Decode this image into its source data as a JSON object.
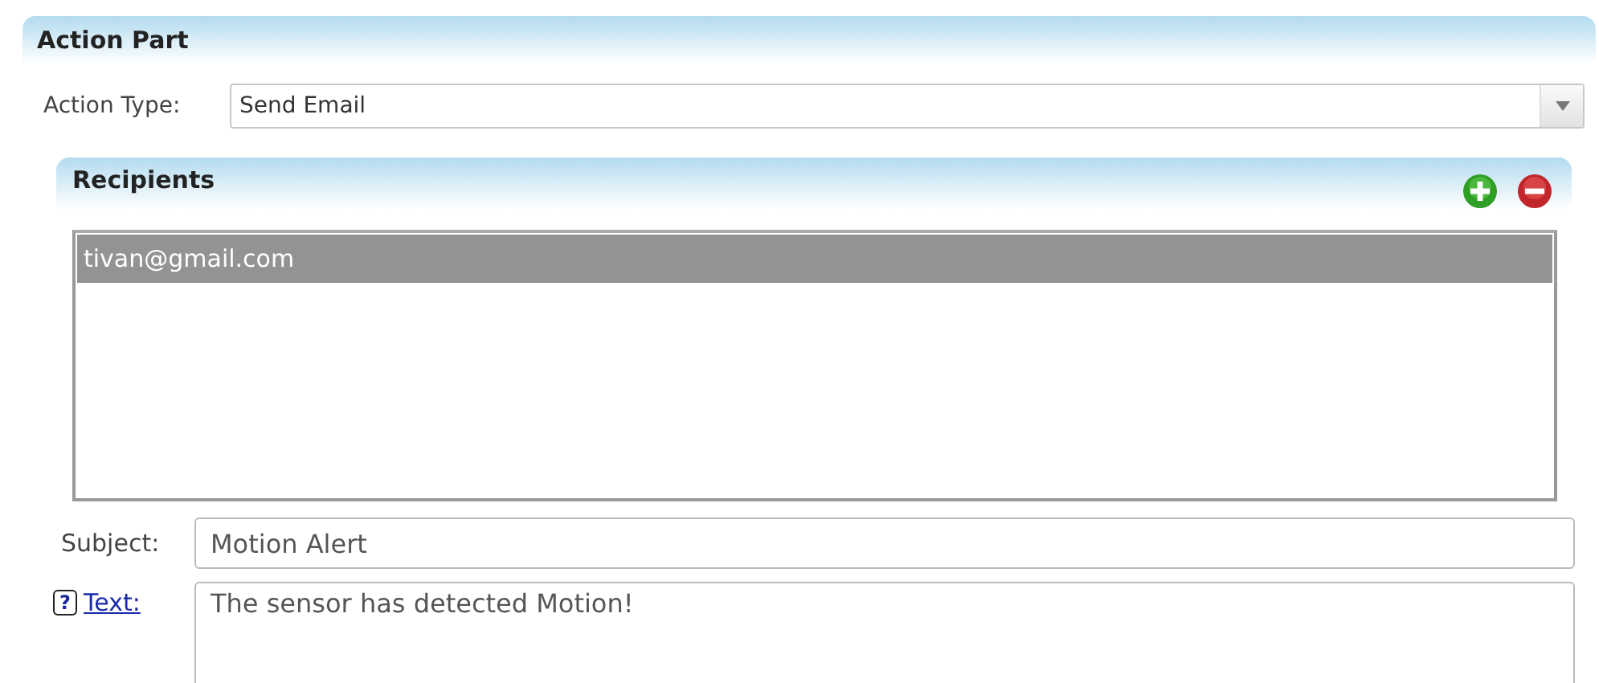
{
  "section": {
    "title": "Action Part"
  },
  "action_type": {
    "label": "Action Type:",
    "value": "Send Email"
  },
  "recipients": {
    "title": "Recipients",
    "items": [
      {
        "address": "tivan@gmail.com",
        "selected": true
      }
    ]
  },
  "subject": {
    "label": "Subject:",
    "value": "Motion Alert"
  },
  "text": {
    "help": "?",
    "label": "Text:",
    "value": "The sensor has detected Motion!"
  }
}
